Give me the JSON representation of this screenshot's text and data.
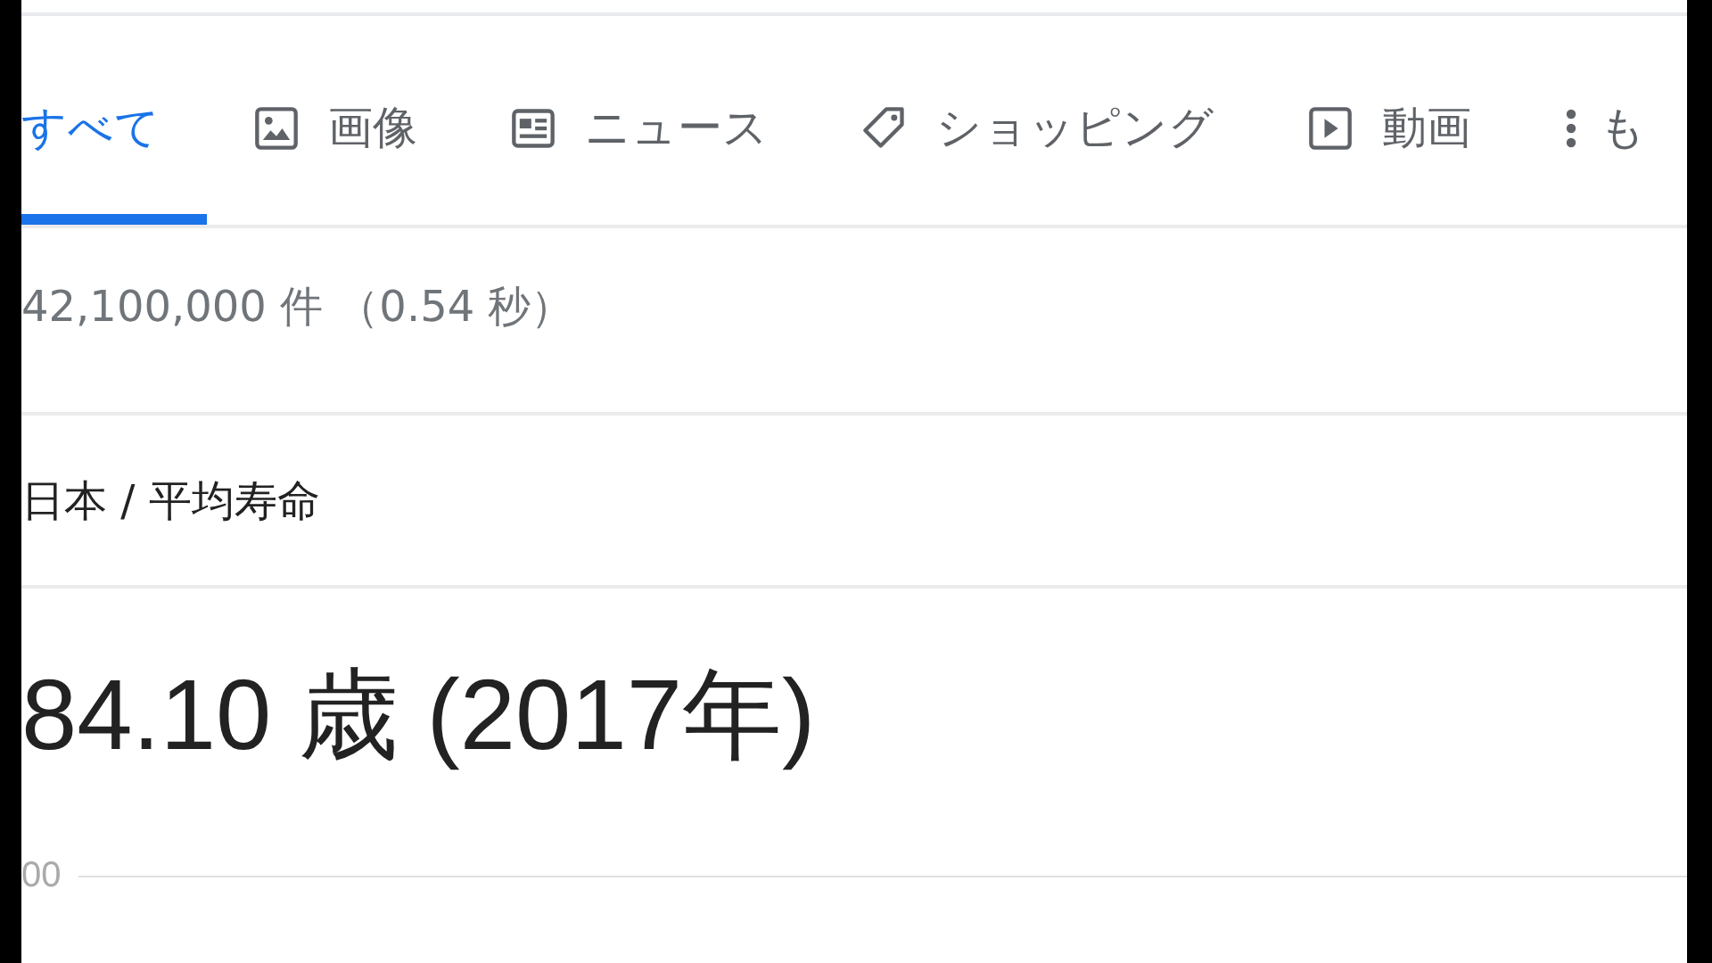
{
  "tabs": [
    {
      "label": "すべて",
      "kind": "all",
      "selected": true
    },
    {
      "label": "画像",
      "kind": "images",
      "selected": false
    },
    {
      "label": "ニュース",
      "kind": "news",
      "selected": false
    },
    {
      "label": "ショッピング",
      "kind": "shopping",
      "selected": false
    },
    {
      "label": "動画",
      "kind": "videos",
      "selected": false
    },
    {
      "label": "も",
      "kind": "more",
      "selected": false
    }
  ],
  "result_stats": "42,100,000 件 （0.54 秒）",
  "breadcrumb": "日本 / 平均寿命",
  "answer": "84.10 歳 (2017年)",
  "chart_axis_label": "00"
}
